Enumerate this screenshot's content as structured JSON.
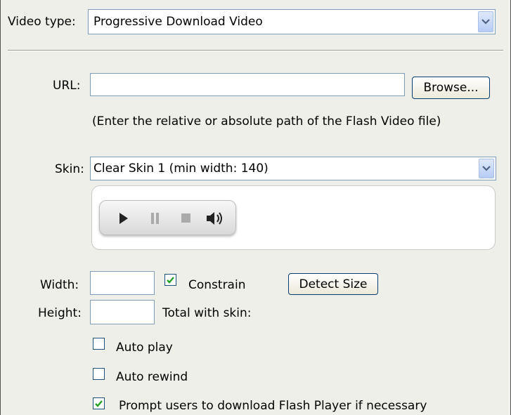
{
  "video_type": {
    "label": "Video type:",
    "selected": "Progressive Download Video"
  },
  "url": {
    "label": "URL:",
    "value": "",
    "browse_label": "Browse...",
    "hint": "(Enter the relative or absolute path of the Flash Video file)"
  },
  "skin": {
    "label": "Skin:",
    "selected": "Clear Skin 1 (min width: 140)"
  },
  "size": {
    "width_label": "Width:",
    "width_value": "",
    "height_label": "Height:",
    "height_value": "",
    "constrain_label": "Constrain",
    "constrain_checked": true,
    "detect_label": "Detect Size",
    "total_label": "Total with skin:"
  },
  "options": {
    "auto_play_label": "Auto play",
    "auto_play_checked": false,
    "auto_rewind_label": "Auto rewind",
    "auto_rewind_checked": false,
    "prompt_label": "Prompt users to download Flash Player if necessary",
    "prompt_checked": true
  },
  "icons": {
    "dropdown": "chevron-down-icon",
    "check": "checkmark-icon",
    "play": "play-icon",
    "pause": "pause-icon",
    "stop": "stop-icon",
    "volume": "speaker-icon"
  },
  "colors": {
    "panel_bg": "#efefe9",
    "field_border": "#7f9db9",
    "check_green": "#21a121"
  }
}
